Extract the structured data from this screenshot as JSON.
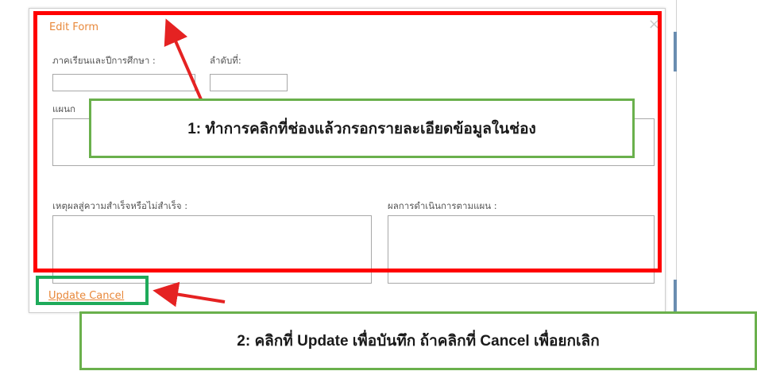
{
  "dialog": {
    "title": "Edit Form",
    "close_glyph": "×",
    "fields": {
      "semester_label": "ภาคเรียนและปีการศึกษา :",
      "semester_value": "",
      "order_label": "ลำดับที่:",
      "order_value": "",
      "plan_label": "แผนก",
      "plan_value": "",
      "reason_label": "เหตุผลสู่ความสำเร็จหรือไม่สำเร็จ :",
      "reason_value": "",
      "result_label": "ผลการดำเนินการตามแผน :",
      "result_value": ""
    },
    "actions": {
      "update_label": "Update",
      "cancel_label": "Cancel"
    }
  },
  "annotations": {
    "callout_1": "1: ทำการคลิกที่ช่องแล้วกรอกรายละเอียดข้อมูลในช่อง",
    "callout_2": "2: คลิกที่ Update เพื่อบันทึก ถ้าคลิกที่ Cancel เพื่อยกเลิก"
  },
  "colors": {
    "accent_orange": "#e8883a",
    "annotation_red": "#ff0000",
    "callout_green": "#6ab04c",
    "highlight_green": "#1eaa5a"
  }
}
